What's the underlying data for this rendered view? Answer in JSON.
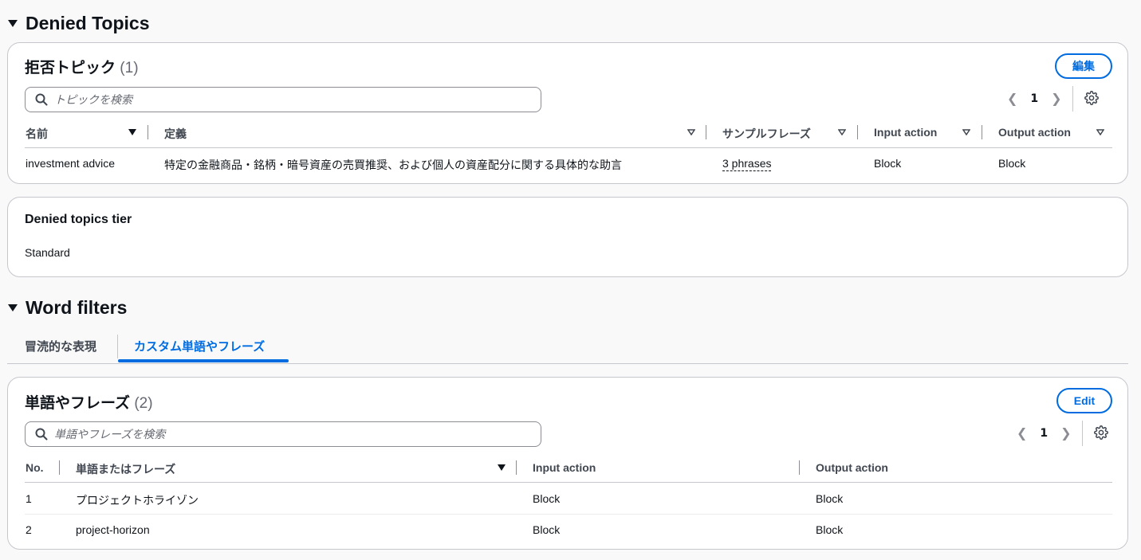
{
  "denied_topics_section": {
    "heading": "Denied Topics",
    "card": {
      "title": "拒否トピック",
      "count": "(1)",
      "edit_label": "編集",
      "search_placeholder": "トピックを検索",
      "page": "1",
      "columns": [
        "名前",
        "定義",
        "サンプルフレーズ",
        "Input action",
        "Output action"
      ],
      "rows": [
        {
          "name": "investment advice",
          "definition": "特定の金融商品・銘柄・暗号資産の売買推奨、および個人の資産配分に関する具体的な助言",
          "sample_phrases": "3 phrases",
          "input_action": "Block",
          "output_action": "Block"
        }
      ]
    },
    "tier": {
      "title": "Denied topics tier",
      "value": "Standard"
    }
  },
  "word_filters_section": {
    "heading": "Word filters",
    "tabs": [
      {
        "label": "冒涜的な表現",
        "active": false
      },
      {
        "label": "カスタム単語やフレーズ",
        "active": true
      }
    ],
    "card": {
      "title": "単語やフレーズ",
      "count": "(2)",
      "edit_label": "Edit",
      "search_placeholder": "単語やフレーズを検索",
      "page": "1",
      "columns": [
        "No.",
        "単語またはフレーズ",
        "Input action",
        "Output action"
      ],
      "rows": [
        {
          "no": "1",
          "phrase": "プロジェクトホライゾン",
          "input_action": "Block",
          "output_action": "Block"
        },
        {
          "no": "2",
          "phrase": "project-horizon",
          "input_action": "Block",
          "output_action": "Block"
        }
      ]
    }
  },
  "icons": {
    "collapse": "caret-down-icon",
    "search": "search-icon",
    "settings": "gear-icon",
    "prev": "chevron-left-icon",
    "next": "chevron-right-icon"
  },
  "colors": {
    "accent": "#006ce0",
    "border": "#c6c6cd",
    "text": "#0f141a",
    "muted": "#656871",
    "background": "#f9f9fa"
  }
}
